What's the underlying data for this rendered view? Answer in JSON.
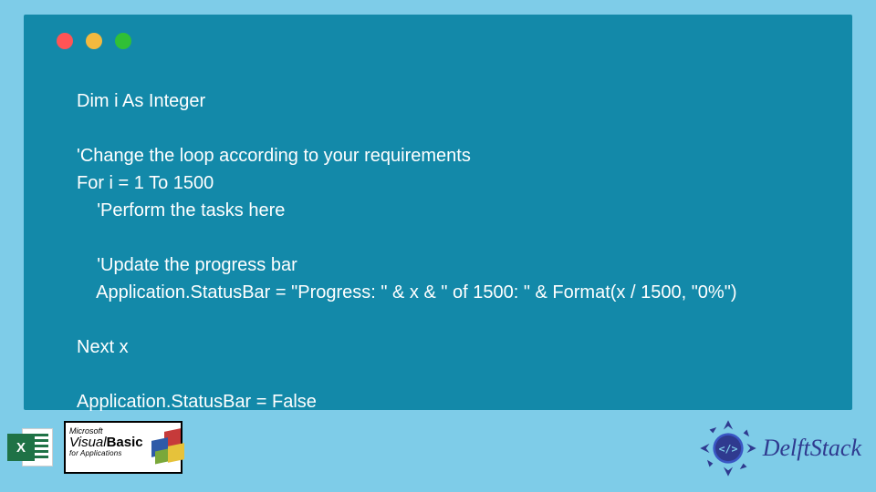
{
  "window": {
    "traffic": {
      "red": "#ff5455",
      "yellow": "#f4b93e",
      "green": "#30c036"
    }
  },
  "code": {
    "line1": "Dim i As Integer",
    "line2": "",
    "line3": "'Change the loop according to your requirements",
    "line4": "For i = 1 To 1500",
    "line5": "    'Perform the tasks here",
    "line6": "",
    "line7": "    'Update the progress bar",
    "line8": "    Application.StatusBar = \"Progress: \" & x & \" of 1500: \" & Format(x / 1500, \"0%\")",
    "line9": "",
    "line10": "Next x",
    "line11": "",
    "line12": "Application.StatusBar = False"
  },
  "footer": {
    "excel_letter": "X",
    "vb_ms": "Microsoft",
    "vb_visual": "Visual",
    "vb_basic": "Basic",
    "vb_sub": "for Applications",
    "brand": "DelftStack"
  }
}
